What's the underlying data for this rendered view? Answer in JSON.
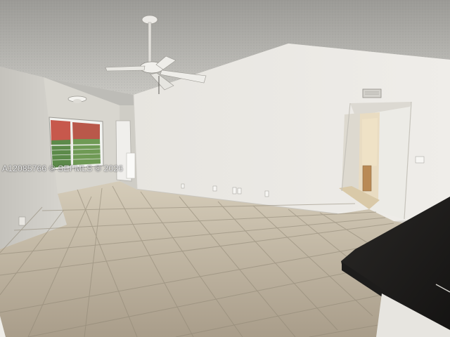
{
  "photo": {
    "watermark": "A12085766 © SEFMLS © 2026"
  }
}
